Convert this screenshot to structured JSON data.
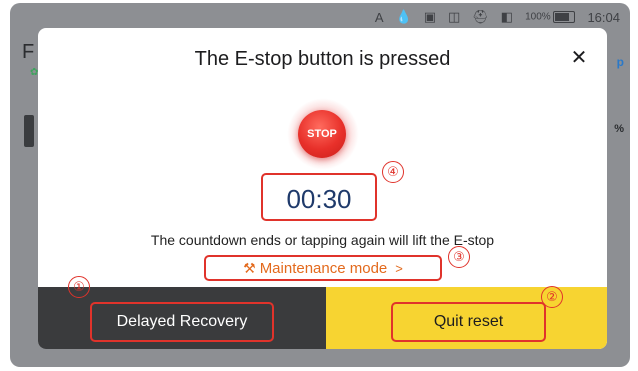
{
  "status_bar": {
    "icons": [
      "a-icon",
      "drop-icon",
      "sim-icon",
      "screenshot-icon",
      "car-icon",
      "no-signal-icon"
    ],
    "letter": "A",
    "battery": "100%",
    "time": "16:04"
  },
  "background": {
    "title_letter": "F",
    "right_letter": "p",
    "percent_suffix": "%"
  },
  "dialog": {
    "title": "The E-stop button is pressed",
    "close_label": "✕",
    "stop_label": "STOP",
    "countdown": "00:30",
    "hint": "The countdown ends or tapping again will lift the E-stop",
    "maintenance_label": "Maintenance mode",
    "maintenance_chevron": ">",
    "delayed_recovery_label": "Delayed Recovery",
    "quit_reset_label": "Quit reset"
  },
  "annotations": {
    "badge_1": "①",
    "badge_2": "②",
    "badge_3": "③",
    "badge_4": "④"
  },
  "colors": {
    "stop_red": "#e8302a",
    "annotation_red": "#e0332b",
    "maintenance_orange": "#e36a1d",
    "footer_dark": "#3a3b3d",
    "footer_yellow": "#f7d431",
    "countdown_navy": "#1f3a6b"
  }
}
